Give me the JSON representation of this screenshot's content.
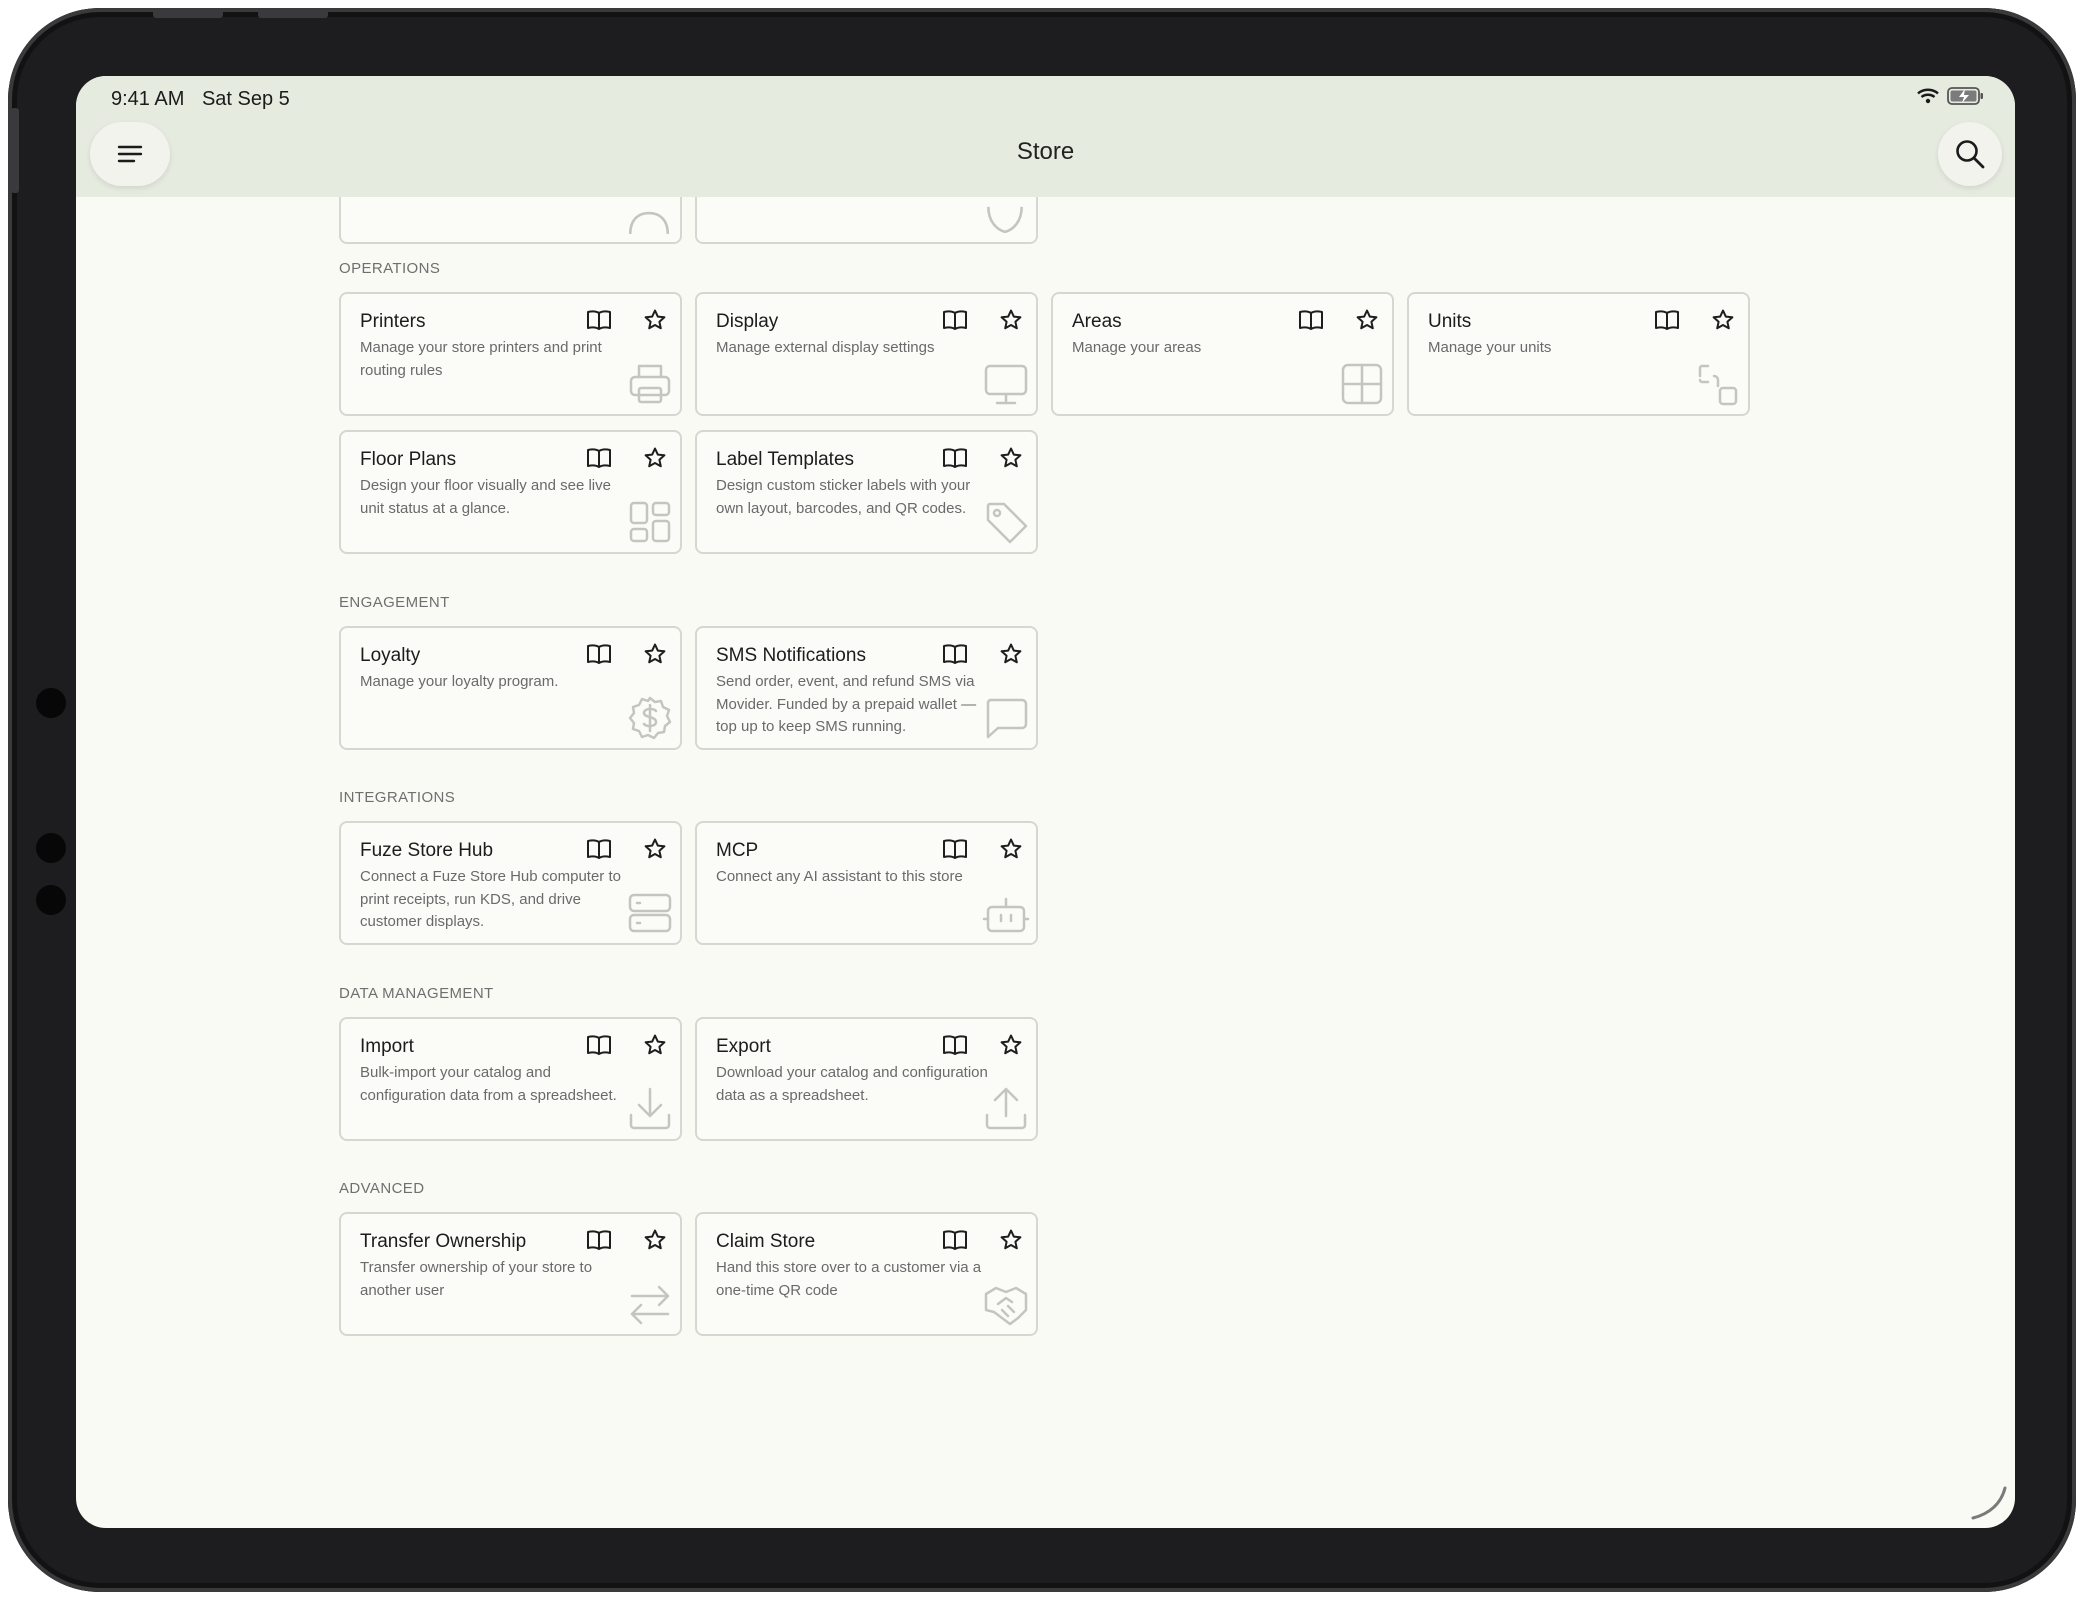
{
  "status_bar": {
    "time": "9:41 AM",
    "date": "Sat Sep 5"
  },
  "header": {
    "title": "Store"
  },
  "sections": [
    {
      "label": "OPERATIONS",
      "cards": [
        {
          "title": "Printers",
          "desc": "Manage your store printers and print routing rules",
          "icon": "printer-icon"
        },
        {
          "title": "Display",
          "desc": "Manage external display settings",
          "icon": "monitor-icon"
        },
        {
          "title": "Areas",
          "desc": "Manage your areas",
          "icon": "grid-icon"
        },
        {
          "title": "Units",
          "desc": "Manage your units",
          "icon": "units-icon"
        },
        {
          "title": "Floor Plans",
          "desc": "Design your floor visually and see live unit status at a glance.",
          "icon": "layout-icon"
        },
        {
          "title": "Label Templates",
          "desc": "Design custom sticker labels with your own layout, barcodes, and QR codes.",
          "icon": "tag-icon"
        }
      ]
    },
    {
      "label": "ENGAGEMENT",
      "cards": [
        {
          "title": "Loyalty",
          "desc": "Manage your loyalty program.",
          "icon": "dollar-badge-icon"
        },
        {
          "title": "SMS Notifications",
          "desc": "Send order, event, and refund SMS via Movider. Funded by a prepaid wallet — top up to keep SMS running.",
          "icon": "chat-bubble-icon"
        }
      ]
    },
    {
      "label": "INTEGRATIONS",
      "cards": [
        {
          "title": "Fuze Store Hub",
          "desc": "Connect a Fuze Store Hub computer to print receipts, run KDS, and drive customer displays.",
          "icon": "server-icon"
        },
        {
          "title": "MCP",
          "desc": "Connect any AI assistant to this store",
          "icon": "robot-icon"
        }
      ]
    },
    {
      "label": "DATA MANAGEMENT",
      "cards": [
        {
          "title": "Import",
          "desc": "Bulk-import your catalog and configuration data from a spreadsheet.",
          "icon": "download-icon"
        },
        {
          "title": "Export",
          "desc": "Download your catalog and configuration data as a spreadsheet.",
          "icon": "upload-icon"
        }
      ]
    },
    {
      "label": "ADVANCED",
      "cards": [
        {
          "title": "Transfer Ownership",
          "desc": "Transfer ownership of your store to another user",
          "icon": "transfer-arrows-icon"
        },
        {
          "title": "Claim Store",
          "desc": "Hand this store over to a customer via a one-time QR code",
          "icon": "handshake-icon"
        }
      ]
    }
  ],
  "colors": {
    "header_bg": "#e6ebe0",
    "page_bg": "#fafaf5",
    "card_border": "#d7d7d2",
    "icon_gray": "#c4c4c0"
  }
}
